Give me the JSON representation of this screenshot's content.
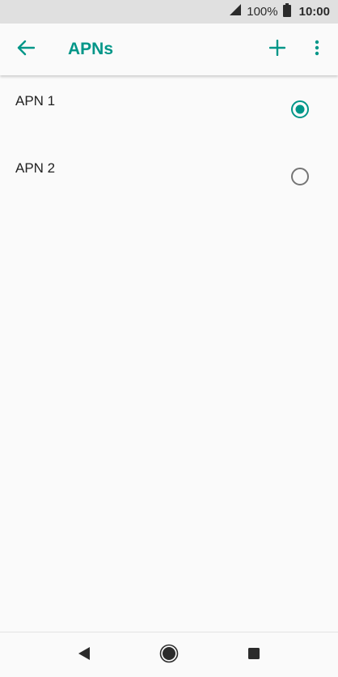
{
  "status_bar": {
    "battery_percent": "100%",
    "time": "10:00",
    "icons": [
      "signal-icon",
      "battery-icon"
    ]
  },
  "app_bar": {
    "title": "APNs",
    "icons": [
      "back-arrow-icon",
      "add-icon",
      "more-vert-icon"
    ]
  },
  "apns": [
    {
      "name": "APN 1",
      "selected": true
    },
    {
      "name": "APN 2",
      "selected": false
    }
  ],
  "nav_bar": {
    "icons": [
      "back-triangle-icon",
      "home-circle-icon",
      "recents-square-icon"
    ]
  },
  "colors": {
    "accent": "#009688",
    "status_bar_bg": "#e0e0e0",
    "background": "#fafafa",
    "text": "#222222",
    "radio_unselected": "#757575"
  }
}
